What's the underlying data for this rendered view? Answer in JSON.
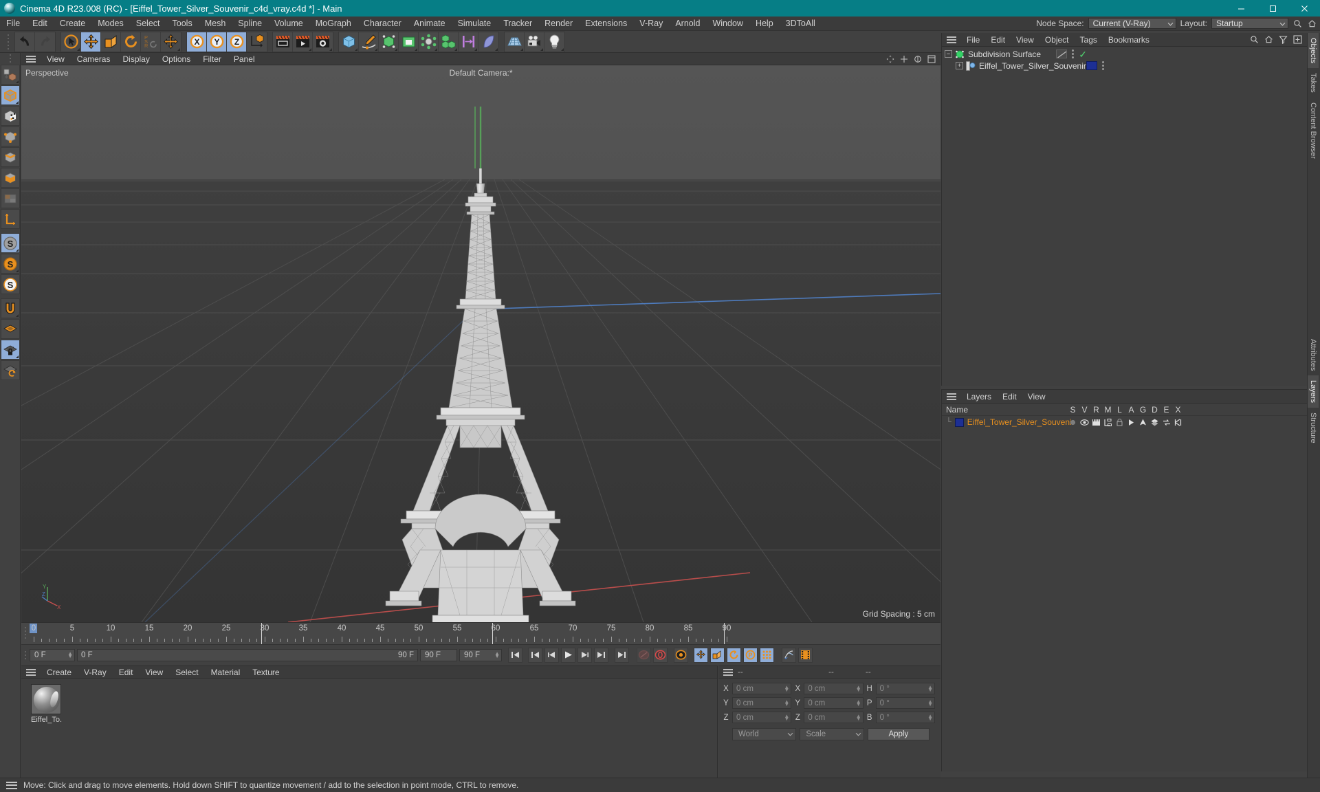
{
  "window": {
    "title": "Cinema 4D R23.008 (RC) - [Eiffel_Tower_Silver_Souvenir_c4d_vray.c4d *] - Main",
    "app_icon": "c4d-logo-icon",
    "minimize": "minimize-button",
    "maximize": "maximize-button",
    "close": "close-button"
  },
  "menubar": {
    "items": [
      "File",
      "Edit",
      "Create",
      "Modes",
      "Select",
      "Tools",
      "Mesh",
      "Spline",
      "Volume",
      "MoGraph",
      "Character",
      "Animate",
      "Simulate",
      "Tracker",
      "Render",
      "Extensions",
      "V-Ray",
      "Arnold",
      "Window",
      "Help",
      "3DToAll"
    ],
    "node_space_label": "Node Space:",
    "node_space_value": "Current (V-Ray)",
    "layout_label": "Layout:",
    "layout_value": "Startup",
    "search_icon": "search-icon",
    "home_icon": "home-icon"
  },
  "viewport": {
    "menu": [
      "View",
      "Cameras",
      "Display",
      "Options",
      "Filter",
      "Panel"
    ],
    "projection_label": "Perspective",
    "camera_label": "Default Camera:*",
    "grid_spacing": "Grid Spacing : 5 cm",
    "axis_x": "X",
    "axis_y": "Y",
    "axis_z": "Z",
    "colors": {
      "x_axis": "#c8504e",
      "y_axis": "#58a85a",
      "z_axis": "#4f7fc4",
      "background_top": "#565656",
      "background_bottom": "#3a3a3a",
      "model": "#d8d8d8"
    }
  },
  "object_manager": {
    "menu": [
      "File",
      "Edit",
      "View",
      "Object",
      "Tags",
      "Bookmarks"
    ],
    "rows": [
      {
        "name": "Subdivision Surface",
        "depth": 0,
        "icon": "subdivision-surface-icon",
        "tag": "display-tag",
        "check": "✓"
      },
      {
        "name": "Eiffel_Tower_Silver_Souvenir",
        "depth": 1,
        "icon": "polygon-object-icon",
        "tag": "layer-tag-blue",
        "check": ""
      }
    ],
    "tools": [
      "search-icon",
      "home-icon",
      "filter-icon",
      "add-icon"
    ]
  },
  "layer_manager": {
    "menu": [
      "Layers",
      "Edit",
      "View"
    ],
    "columns": [
      "Name",
      "S",
      "V",
      "R",
      "M",
      "L",
      "A",
      "G",
      "D",
      "E",
      "X"
    ],
    "rows": [
      {
        "name": "Eiffel_Tower_Silver_Souvenir",
        "color": "#1d2f94"
      }
    ]
  },
  "material_manager": {
    "menu": [
      "Create",
      "V-Ray",
      "Edit",
      "View",
      "Select",
      "Material",
      "Texture"
    ],
    "materials": [
      {
        "name": "Eiffel_To..."
      }
    ]
  },
  "coordinates": {
    "headers": [
      "--",
      "--",
      "--"
    ],
    "position": {
      "label_x": "X",
      "label_y": "Y",
      "label_z": "Z",
      "x": "0 cm",
      "y": "0 cm",
      "z": "0 cm"
    },
    "size": {
      "label_x": "X",
      "label_y": "Y",
      "label_z": "Z",
      "x": "0 cm",
      "y": "0 cm",
      "z": "0 cm"
    },
    "rotation": {
      "label_h": "H",
      "label_p": "P",
      "label_b": "B",
      "h": "0 °",
      "p": "0 °",
      "b": "0 °"
    },
    "coord_system": "World",
    "mode": "Scale",
    "apply": "Apply"
  },
  "timeline": {
    "ticks": [
      "0",
      "5",
      "10",
      "15",
      "20",
      "25",
      "30",
      "35",
      "40",
      "45",
      "50",
      "55",
      "60",
      "65",
      "70",
      "75",
      "80",
      "85",
      "90"
    ],
    "current_frame": "0 F",
    "preview_min": "0 F",
    "preview_max": "90 F",
    "range_end_a": "90 F",
    "range_end_b": "90 F",
    "end_frame_field": "0 F",
    "playhead_frame": 0
  },
  "right_tabs": [
    {
      "label": "Objects",
      "selected": true
    },
    {
      "label": "Takes",
      "selected": false
    },
    {
      "label": "Content Browser",
      "selected": false
    },
    {
      "label": "Attributes",
      "selected": false
    },
    {
      "label": "Layers",
      "selected": true
    },
    {
      "label": "Structure",
      "selected": false
    }
  ],
  "statusbar": {
    "text": "Move: Click and drag to move elements. Hold down SHIFT to quantize movement / add to the selection in point mode, CTRL to remove."
  },
  "toolbar": {
    "groups": [
      {
        "buttons": [
          {
            "name": "undo-button",
            "icon": "undo-icon",
            "selected": false
          },
          {
            "name": "redo-button",
            "icon": "redo-icon",
            "selected": false,
            "dim": true
          }
        ]
      },
      {
        "buttons": [
          {
            "name": "live-selection-tool",
            "icon": "cursor-circle-icon",
            "selected": false,
            "corner": true
          },
          {
            "name": "move-tool",
            "icon": "move-arrows-icon",
            "selected": true
          },
          {
            "name": "scale-tool",
            "icon": "scale-box-icon",
            "selected": false
          },
          {
            "name": "rotate-tool",
            "icon": "rotate-arc-icon",
            "selected": false
          },
          {
            "name": "psr-tool",
            "icon": "psr-icon",
            "selected": false
          },
          {
            "name": "world-local-tool",
            "icon": "move-arrows-icon",
            "selected": false,
            "corner": true
          }
        ]
      },
      {
        "buttons": [
          {
            "name": "axis-x-toggle",
            "icon": "x-axis-icon",
            "selected": true
          },
          {
            "name": "axis-y-toggle",
            "icon": "y-axis-icon",
            "selected": true
          },
          {
            "name": "axis-z-toggle",
            "icon": "z-axis-icon",
            "selected": true
          },
          {
            "name": "world-coordinate-toggle",
            "icon": "world-axis-icon",
            "selected": false
          }
        ]
      },
      {
        "buttons": [
          {
            "name": "render-view-button",
            "icon": "render-view-icon",
            "selected": false
          },
          {
            "name": "render-to-picture-viewer-button",
            "icon": "render-picture-icon",
            "selected": false,
            "corner": true
          },
          {
            "name": "render-settings-button",
            "icon": "render-settings-icon",
            "selected": false,
            "corner": true
          }
        ]
      },
      {
        "buttons": [
          {
            "name": "cube-primitive-button",
            "icon": "cube-icon",
            "selected": false,
            "corner": true
          },
          {
            "name": "spline-pen-button",
            "icon": "pen-icon",
            "selected": false,
            "corner": true
          },
          {
            "name": "generator-button",
            "icon": "nurbs-icon",
            "selected": false,
            "corner": true
          },
          {
            "name": "bend-deformer-button",
            "icon": "deformer-icon",
            "selected": false,
            "corner": true
          },
          {
            "name": "scene-object-button",
            "icon": "environment-icon",
            "selected": false,
            "corner": true
          },
          {
            "name": "mograph-button",
            "icon": "mograph-cubes-icon",
            "selected": false,
            "corner": true
          },
          {
            "name": "field-button",
            "icon": "field-icon",
            "selected": false,
            "corner": true
          },
          {
            "name": "character-button",
            "icon": "cloth-icon",
            "selected": false,
            "corner": true
          }
        ]
      },
      {
        "buttons": [
          {
            "name": "ground-button",
            "icon": "ground-grid-icon",
            "selected": false,
            "corner": true
          },
          {
            "name": "camera-button",
            "icon": "camera-icon",
            "selected": false,
            "corner": true
          },
          {
            "name": "light-button",
            "icon": "light-bulb-icon",
            "selected": false,
            "corner": true
          }
        ]
      }
    ]
  },
  "left_toolbar": [
    {
      "name": "make-editable-button",
      "icon": "make-editable-icon",
      "selected": false,
      "corner": true
    },
    {
      "name": "model-mode-button",
      "icon": "model-mode-icon",
      "selected": true,
      "corner": true
    },
    {
      "name": "texture-mode-button",
      "icon": "texture-mode-icon",
      "selected": false
    },
    {
      "name": "points-mode-button",
      "icon": "points-mode-icon",
      "selected": false
    },
    {
      "name": "edges-mode-button",
      "icon": "edges-mode-icon",
      "selected": false
    },
    {
      "name": "polygons-mode-button",
      "icon": "polygons-mode-icon",
      "selected": false
    },
    {
      "name": "uv-mode-button",
      "icon": "uv-mode-icon",
      "selected": false
    },
    {
      "name": "axis-mode-button",
      "icon": "axis-mode-icon",
      "selected": false
    },
    {
      "name": "enable-snapping-button",
      "icon": "snap-s-gray-icon",
      "selected": true,
      "corner": true
    },
    {
      "name": "quantize-button",
      "icon": "snap-s-orange-icon",
      "selected": false,
      "corner": true
    },
    {
      "name": "workplane-button",
      "icon": "snap-s-white-icon",
      "selected": false
    },
    {
      "name": "magnet-tool-button",
      "icon": "magnet-icon",
      "selected": false,
      "corner": true
    },
    {
      "name": "workplane-grid-button",
      "icon": "grid-plane-icon",
      "selected": false
    },
    {
      "name": "lock-workplane-button",
      "icon": "grid-lock-icon",
      "selected": true,
      "corner": true
    },
    {
      "name": "planar-workplane-button",
      "icon": "grid-rotate-icon",
      "selected": false
    }
  ]
}
